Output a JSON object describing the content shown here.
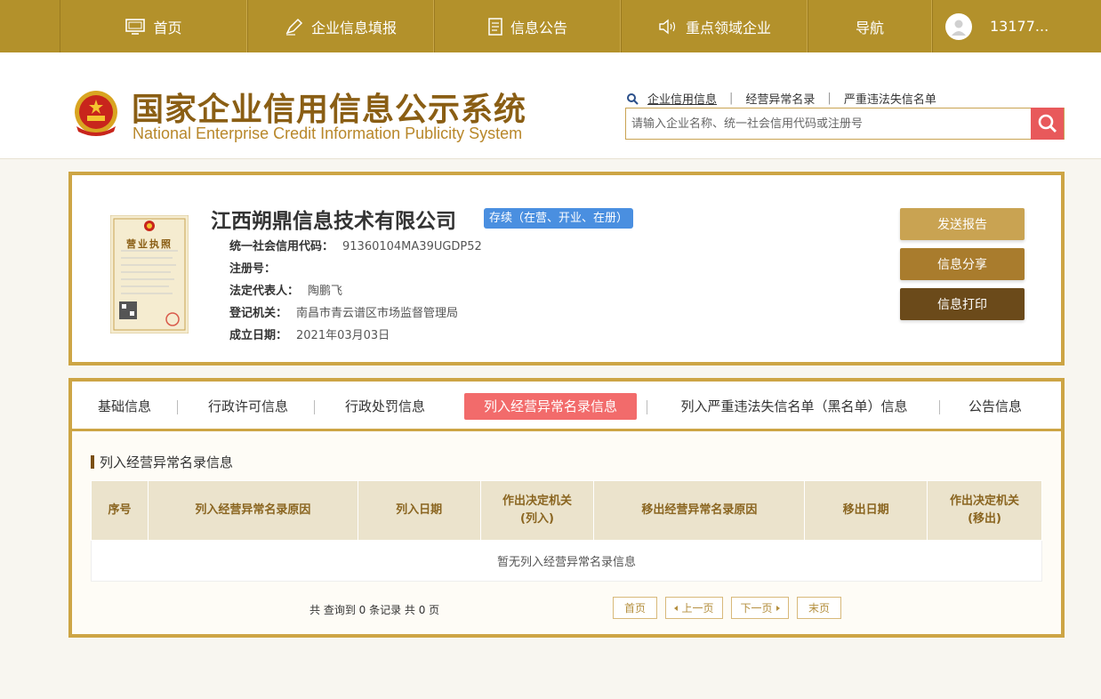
{
  "nav": {
    "items": [
      {
        "label": "首页",
        "icon": "monitor-icon"
      },
      {
        "label": "企业信息填报",
        "icon": "edit-icon"
      },
      {
        "label": "信息公告",
        "icon": "document-icon"
      },
      {
        "label": "重点领域企业",
        "icon": "speaker-icon"
      },
      {
        "label": "导航",
        "icon": ""
      }
    ],
    "user": "13177..."
  },
  "site": {
    "title_cn": "国家企业信用信息公示系统",
    "title_en": "National Enterprise Credit Information Publicity System"
  },
  "search": {
    "links": [
      "企业信用信息",
      "经营异常名录",
      "严重违法失信名单"
    ],
    "placeholder": "请输入企业名称、统一社会信用代码或注册号"
  },
  "company": {
    "name": "江西朔鼎信息技术有限公司",
    "status": "存续（在营、开业、在册）",
    "fields": [
      {
        "label": "统一社会信用代码：",
        "value": "91360104MA39UGDP52"
      },
      {
        "label": "注册号：",
        "value": ""
      },
      {
        "label": "法定代表人：",
        "value": "陶鹏飞"
      },
      {
        "label": "登记机关：",
        "value": "南昌市青云谱区市场监督管理局"
      },
      {
        "label": "成立日期：",
        "value": "2021年03月03日"
      }
    ],
    "license_label": "营业执照"
  },
  "actions": {
    "send_report": "发送报告",
    "share": "信息分享",
    "print": "信息打印"
  },
  "tabs": [
    {
      "label": "基础信息",
      "active": false
    },
    {
      "label": "行政许可信息",
      "active": false
    },
    {
      "label": "行政处罚信息",
      "active": false
    },
    {
      "label": "列入经营异常名录信息",
      "active": true
    },
    {
      "label": "列入严重违法失信名单（黑名单）信息",
      "active": false
    },
    {
      "label": "公告信息",
      "active": false
    }
  ],
  "section": {
    "title": "列入经营异常名录信息",
    "columns": [
      "序号",
      "列入经营异常名录原因",
      "列入日期",
      "作出决定机关\n(列入)",
      "移出经营异常名录原因",
      "移出日期",
      "作出决定机关\n(移出)"
    ],
    "empty": "暂无列入经营异常名录信息"
  },
  "pager": {
    "summary": "共 查询到 0 条记录 共 0 页",
    "first": "首页",
    "prev": "上一页",
    "next": "下一页",
    "last": "末页"
  }
}
